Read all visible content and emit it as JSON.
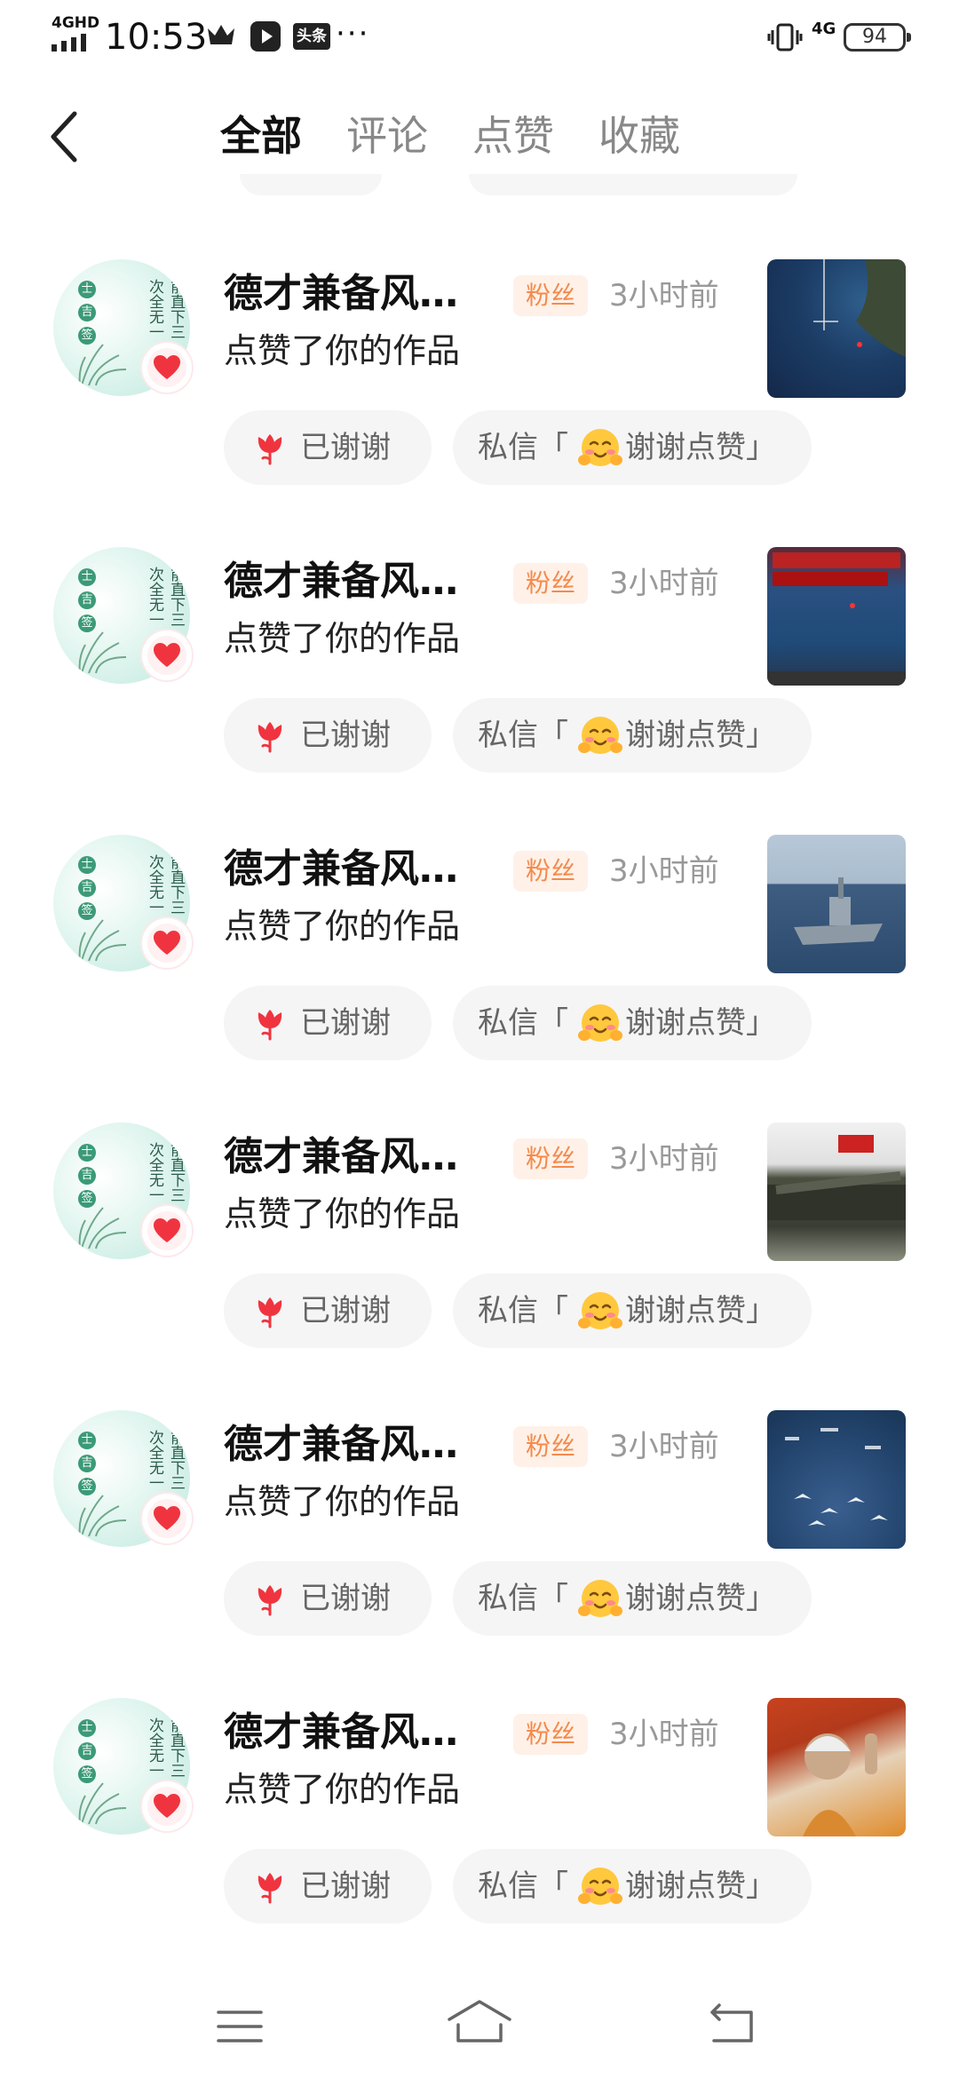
{
  "status_bar": {
    "network": "4GHD",
    "time": "10:53",
    "toutiao_icon_text": "头条",
    "more": "···",
    "signal_4g": "4G",
    "battery": "94"
  },
  "header": {
    "back_icon": "chevron-left-icon",
    "tabs": [
      {
        "label": "全部",
        "active": true
      },
      {
        "label": "评论",
        "active": false
      },
      {
        "label": "点赞",
        "active": false
      },
      {
        "label": "收藏",
        "active": false
      }
    ]
  },
  "notifications": [
    {
      "name": "德才兼备风…",
      "badge": "粉丝",
      "time": "3小时前",
      "action": "点赞了你的作品",
      "thanked_label": "已谢谢",
      "dm_prefix": "私信「",
      "dm_text": "谢谢点赞」",
      "thumbnail": "map-thumbnail"
    },
    {
      "name": "德才兼备风…",
      "badge": "粉丝",
      "time": "3小时前",
      "action": "点赞了你的作品",
      "thanked_label": "已谢谢",
      "dm_prefix": "私信「",
      "dm_text": "谢谢点赞」",
      "thumbnail": "map-news-thumbnail"
    },
    {
      "name": "德才兼备风…",
      "badge": "粉丝",
      "time": "3小时前",
      "action": "点赞了你的作品",
      "thanked_label": "已谢谢",
      "dm_prefix": "私信「",
      "dm_text": "谢谢点赞」",
      "thumbnail": "warship-thumbnail"
    },
    {
      "name": "德才兼备风…",
      "badge": "粉丝",
      "time": "3小时前",
      "action": "点赞了你的作品",
      "thanked_label": "已谢谢",
      "dm_prefix": "私信「",
      "dm_text": "谢谢点赞」",
      "thumbnail": "missile-parade-thumbnail"
    },
    {
      "name": "德才兼备风…",
      "badge": "粉丝",
      "time": "3小时前",
      "action": "点赞了你的作品",
      "thanked_label": "已谢谢",
      "dm_prefix": "私信「",
      "dm_text": "谢谢点赞」",
      "thumbnail": "fleet-thumbnail"
    },
    {
      "name": "德才兼备风…",
      "badge": "粉丝",
      "time": "3小时前",
      "action": "点赞了你的作品",
      "thanked_label": "已谢谢",
      "dm_prefix": "私信「",
      "dm_text": "谢谢点赞」",
      "thumbnail": "portrait-thumbnail"
    }
  ],
  "avatar_text": {
    "seal": [
      "士",
      "吉",
      "签"
    ],
    "col1": "次全无一",
    "col2": "前直下三"
  },
  "colors": {
    "badge_bg": "#fff1e8",
    "badge_text": "#f48a4c",
    "heart": "#f0343f",
    "button_bg": "#f5f5f6"
  },
  "nav_bar": {
    "menu_icon": "menu-icon",
    "home_icon": "home-icon",
    "back_icon": "back-icon"
  }
}
